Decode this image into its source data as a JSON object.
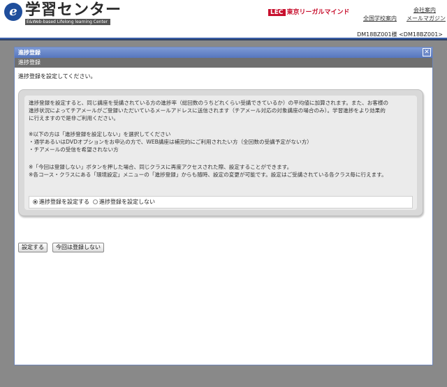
{
  "header": {
    "logo_title": "学習センター",
    "logo_subtitle": "E&Web-based Lifelong learning Center",
    "brand_box": "LEC",
    "brand_name": "東京リーガルマインド",
    "link_company": "会社案内",
    "link_schools": "全国学校案内",
    "link_magazine": "メールマガジン",
    "user_label": "DM18BZ001様 <DM18BZ001>"
  },
  "dialog": {
    "title": "進捗登録",
    "close_symbol": "✕",
    "subtitle": "進捗登録",
    "intro": "進捗登録を設定してください。",
    "para1_line1": "進捗登録を設定すると、同じ講座を受講されている方の進捗率（総回数のうちどれくらい受講できているか）の平均値に加算されます。また、お客様の",
    "para1_line2": "進捗状況によってチアメールがご登録いただいているメールアドレスに送信されます（チアメール対応の対象講座の場合のみ）。学習進捗をより効果的",
    "para1_line3": "に行えますので是非ご利用ください。",
    "para2_line1": "※以下の方は「進捗登録を設定しない」を選択してください",
    "para2_line2": "・通学あるいはDVDオプションをお申込の方で、WEB講座は補完的にご利用されたい方（全回数の受講予定がない方）",
    "para2_line3": "・チアメールの受信を希望されない方",
    "para3_line1": "※「今回は登録しない」ボタンを押した場合、同じクラスに再度アクセスされた際、設定することができます。",
    "para3_line2": "※各コース・クラスにある「環境設定」メニューの「進捗登録」からも随時、設定の変更が可能です。設定はご受講されている各クラス毎に行えます。",
    "radio_set": "進捗登録を設定する",
    "radio_not_set": "進捗登録を設定しない",
    "selected_option": "進捗登録を設定する",
    "btn_set": "設定する",
    "btn_skip": "今回は登録しない"
  }
}
